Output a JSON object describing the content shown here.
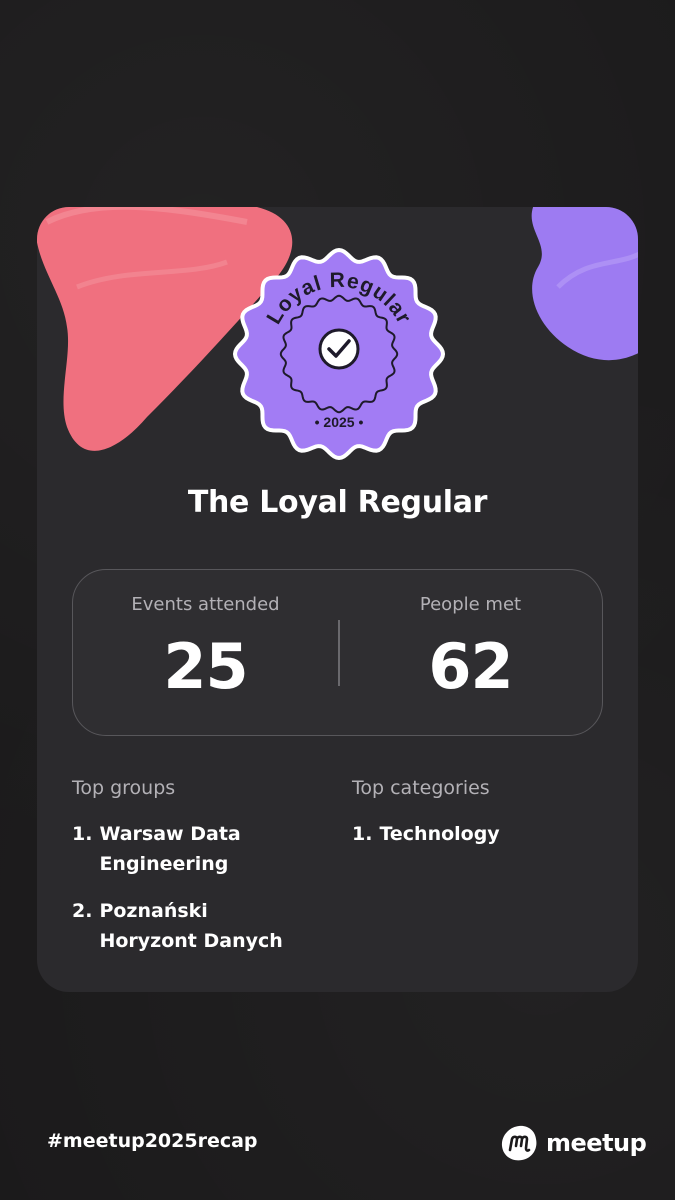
{
  "badge": {
    "arc_text": "Loyal Regular",
    "year": "• 2025 •"
  },
  "title": "The Loyal Regular",
  "stats": [
    {
      "label": "Events attended",
      "value": "25"
    },
    {
      "label": "People met",
      "value": "62"
    }
  ],
  "top_groups": {
    "heading": "Top groups",
    "items": [
      {
        "num": "1.",
        "name": "Warsaw Data Engineering",
        "lines": [
          "Warsaw Data",
          "Engineering"
        ]
      },
      {
        "num": "2.",
        "name": "Poznański Horyzont Danych",
        "lines": [
          "Poznański",
          "Horyzont Danych"
        ]
      }
    ]
  },
  "top_categories": {
    "heading": "Top categories",
    "items": [
      {
        "num": "1.",
        "name": "Technology"
      }
    ]
  },
  "footer": {
    "hashtag": "#meetup2025recap",
    "brand": "meetup"
  },
  "colors": {
    "background": "#1b1a1b",
    "card": "#2b2a2d",
    "badge_purple": "#a27cf4",
    "blob_pink": "#f0707f",
    "blob_purple": "#9d7bf2",
    "brand_pink": "#f0365b"
  },
  "icons": {
    "badge_center": "check-circle-icon",
    "brand": "meetup-logo-icon"
  }
}
